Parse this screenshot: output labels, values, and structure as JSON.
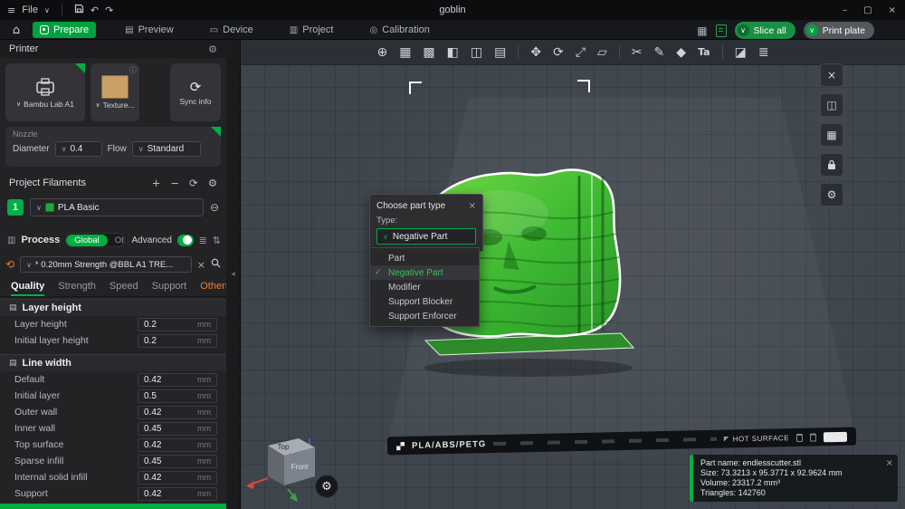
{
  "titlebar": {
    "menu_label": "File",
    "title": "goblin"
  },
  "tabbar": {
    "tabs": [
      "Prepare",
      "Preview",
      "Device",
      "Project",
      "Calibration"
    ],
    "slice_label": "Slice all",
    "print_label": "Print plate"
  },
  "sidebar": {
    "printer_header": "Printer",
    "printer_name": "Bambu Lab A1",
    "texture_label": "Texture...",
    "sync_label": "Sync info",
    "nozzle_header": "Nozzle",
    "diameter_label": "Diameter",
    "diameter_value": "0.4",
    "flow_label": "Flow",
    "flow_value": "Standard",
    "filaments_header": "Project Filaments",
    "filament_index": "1",
    "filament_name": "PLA Basic",
    "process_header": "Process",
    "process_global": "Global",
    "process_objects": "Objects",
    "advanced_label": "Advanced",
    "preset_value": "* 0.20mm Strength @BBL A1 TRE...",
    "tabs": [
      "Quality",
      "Strength",
      "Speed",
      "Support",
      "Others"
    ],
    "groups": [
      {
        "title": "Layer height",
        "rows": [
          {
            "label": "Layer height",
            "value": "0.2",
            "unit": "mm"
          },
          {
            "label": "Initial layer height",
            "value": "0.2",
            "unit": "mm"
          }
        ]
      },
      {
        "title": "Line width",
        "rows": [
          {
            "label": "Default",
            "value": "0.42",
            "unit": "mm"
          },
          {
            "label": "Initial layer",
            "value": "0.5",
            "unit": "mm"
          },
          {
            "label": "Outer wall",
            "value": "0.42",
            "unit": "mm"
          },
          {
            "label": "Inner wall",
            "value": "0.45",
            "unit": "mm"
          },
          {
            "label": "Top surface",
            "value": "0.42",
            "unit": "mm"
          },
          {
            "label": "Sparse infill",
            "value": "0.45",
            "unit": "mm"
          },
          {
            "label": "Internal solid infill",
            "value": "0.42",
            "unit": "mm"
          },
          {
            "label": "Support",
            "value": "0.42",
            "unit": "mm"
          }
        ]
      }
    ]
  },
  "viewport": {
    "vp_toolbar": [
      {
        "name": "add-plate",
        "glyph": "⊕"
      },
      {
        "name": "arrange-objects",
        "glyph": "▦"
      },
      {
        "name": "arrange-plate",
        "glyph": "▩"
      },
      {
        "name": "auto-orient",
        "glyph": "◧"
      },
      {
        "name": "split-to-objects",
        "glyph": "◫"
      },
      {
        "name": "split-to-parts",
        "glyph": "▤"
      },
      {
        "name": "move",
        "glyph": "✥"
      },
      {
        "name": "rotate",
        "glyph": "⟳"
      },
      {
        "name": "scale",
        "glyph": "⤢"
      },
      {
        "name": "flatten",
        "glyph": "▱"
      },
      {
        "name": "cut",
        "glyph": "✂"
      },
      {
        "name": "paint-support",
        "glyph": "✎"
      },
      {
        "name": "seam",
        "glyph": "◆"
      },
      {
        "name": "text-tool",
        "glyph": "Ta"
      },
      {
        "name": "sweep",
        "glyph": "◪"
      },
      {
        "name": "variable-layer-height",
        "glyph": "≣"
      }
    ],
    "vp_right": [
      {
        "name": "exit-tool",
        "glyph": "×"
      },
      {
        "name": "view-cube",
        "glyph": "◫"
      },
      {
        "name": "plate-settings",
        "glyph": "▦"
      },
      {
        "name": "render-options",
        "glyph": "⚙"
      }
    ],
    "dialog": {
      "title": "Choose part type",
      "type_label": "Type:",
      "selected": "Negative Part",
      "options": [
        "Part",
        "Negative Part",
        "Modifier",
        "Support Blocker",
        "Support Enforcer"
      ]
    },
    "plate_material": "PLA/ABS/PETG",
    "plate_surface": "HOT SURFACE",
    "gizmo_top": "Top",
    "gizmo_front": "Front",
    "info": {
      "part_name": "Part name: endlesscutter.stl",
      "size": "Size: 73.3213 x 95.3771 x 92.9624 mm",
      "volume": "Volume: 23317.2 mm³",
      "triangles": "Triangles: 142760"
    }
  },
  "icons": {
    "menu": "≡",
    "chevron": "∨",
    "undo": "↶",
    "redo": "↷",
    "minimize": "–",
    "maximize": "▢",
    "close": "×",
    "home": "⌂",
    "preview_tab": "▤",
    "device_tab": "▭",
    "project_tab": "▥",
    "calibration_tab": "◎",
    "assembly": "▦",
    "gear": "⚙",
    "plus": "+",
    "minus": "−",
    "sync": "⟳",
    "remove": "⊖",
    "reset": "⟲",
    "list": "≣",
    "tune": "⇅",
    "info": "ⓘ",
    "check": "✓",
    "hot_arrow": "◤",
    "collapse": "◂",
    "process": "▥",
    "group": "▤"
  },
  "colors": {
    "accent": "#00ae42",
    "model": "#3db832",
    "warning": "#ef7c2e"
  }
}
